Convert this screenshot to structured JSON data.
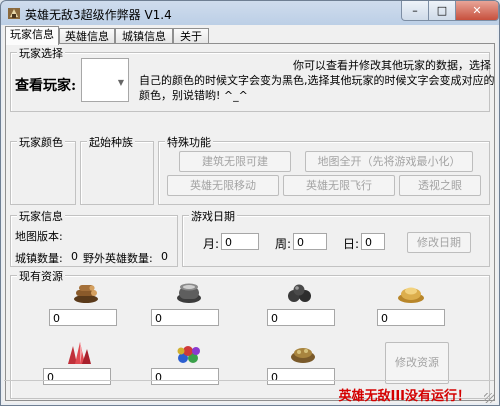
{
  "window": {
    "title": "英雄无敌3超级作弊器 V1.4",
    "min_glyph": "–",
    "max_glyph": "□",
    "close_glyph": "✕"
  },
  "tabs": [
    "玩家信息",
    "英雄信息",
    "城镇信息",
    "关于"
  ],
  "player_select": {
    "group_label": "玩家选择",
    "view_label": "查看玩家:",
    "info_lines": [
      "你可以查看并修改其他玩家的数据，选择",
      "自己的颜色的时候文字会变为黑色,选择其他玩家的时候文字会变成对应的",
      "颜色，别说错哟! ^_^"
    ]
  },
  "player_color": {
    "group_label": "玩家颜色"
  },
  "start_race": {
    "group_label": "起始种族"
  },
  "special": {
    "group_label": "特殊功能",
    "buttons": [
      "建筑无限可建",
      "地图全开（先将游戏最小化）",
      "英雄无限移动",
      "英雄无限飞行",
      "透视之眼"
    ]
  },
  "player_info": {
    "group_label": "玩家信息",
    "map_version_label": "地图版本:",
    "town_count_label": "城镇数量:",
    "town_count": "0",
    "wild_hero_label": "野外英雄数量:",
    "wild_hero_count": "0"
  },
  "game_date": {
    "group_label": "游戏日期",
    "month_label": "月:",
    "month_value": "0",
    "week_label": "周:",
    "week_value": "0",
    "day_label": "日:",
    "day_value": "0",
    "modify_button": "修改日期"
  },
  "resources": {
    "group_label": "现有资源",
    "items": [
      {
        "name": "wood",
        "value": "0"
      },
      {
        "name": "mercury",
        "value": "0"
      },
      {
        "name": "ore",
        "value": "0"
      },
      {
        "name": "gold",
        "value": "0"
      },
      {
        "name": "crystal",
        "value": "0"
      },
      {
        "name": "gems",
        "value": "0"
      },
      {
        "name": "sulfur",
        "value": "0"
      }
    ],
    "modify_button": "修改资源"
  },
  "status": {
    "text": "英雄无敌III没有运行！",
    "color": "#d40000"
  }
}
